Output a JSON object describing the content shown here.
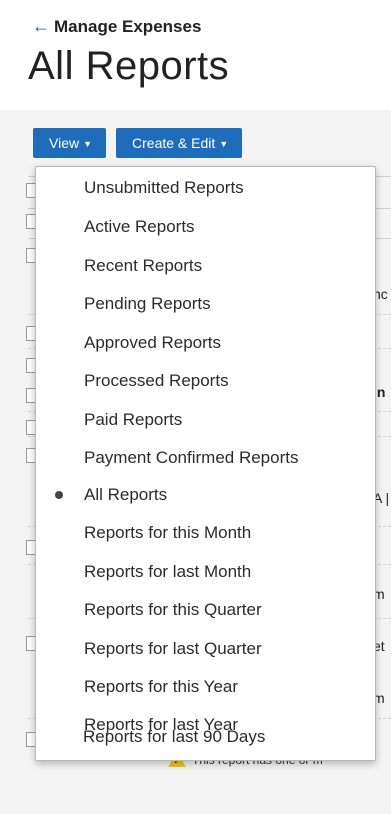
{
  "header": {
    "back_label": "Manage Expenses",
    "title": "All Reports"
  },
  "toolbar": {
    "view_label": "View",
    "create_label": "Create & Edit"
  },
  "menu": {
    "selected": "All Reports",
    "items": [
      {
        "label": "Unsubmitted Reports"
      },
      {
        "label": "Active Reports"
      },
      {
        "label": "Recent Reports"
      },
      {
        "label": "Pending Reports"
      },
      {
        "label": "Approved Reports"
      },
      {
        "label": "Processed Reports"
      },
      {
        "label": "Paid Reports"
      },
      {
        "label": "Payment Confirmed Reports"
      },
      {
        "label": "All Reports"
      },
      {
        "label": "Reports for this Month"
      },
      {
        "label": "Reports for last Month"
      },
      {
        "label": "Reports for this Quarter"
      },
      {
        "label": "Reports for last Quarter"
      },
      {
        "label": "Reports for this Year"
      },
      {
        "label": "Reports for last Year"
      },
      {
        "label": "Reports for last 90 Days"
      }
    ]
  },
  "background": {
    "fragments": [
      {
        "text": "nc"
      },
      {
        "text": "in"
      },
      {
        "text": "A |"
      },
      {
        "text": "m"
      },
      {
        "text": "et"
      },
      {
        "text": "m"
      }
    ],
    "warning_text": "This report has one or m"
  }
}
